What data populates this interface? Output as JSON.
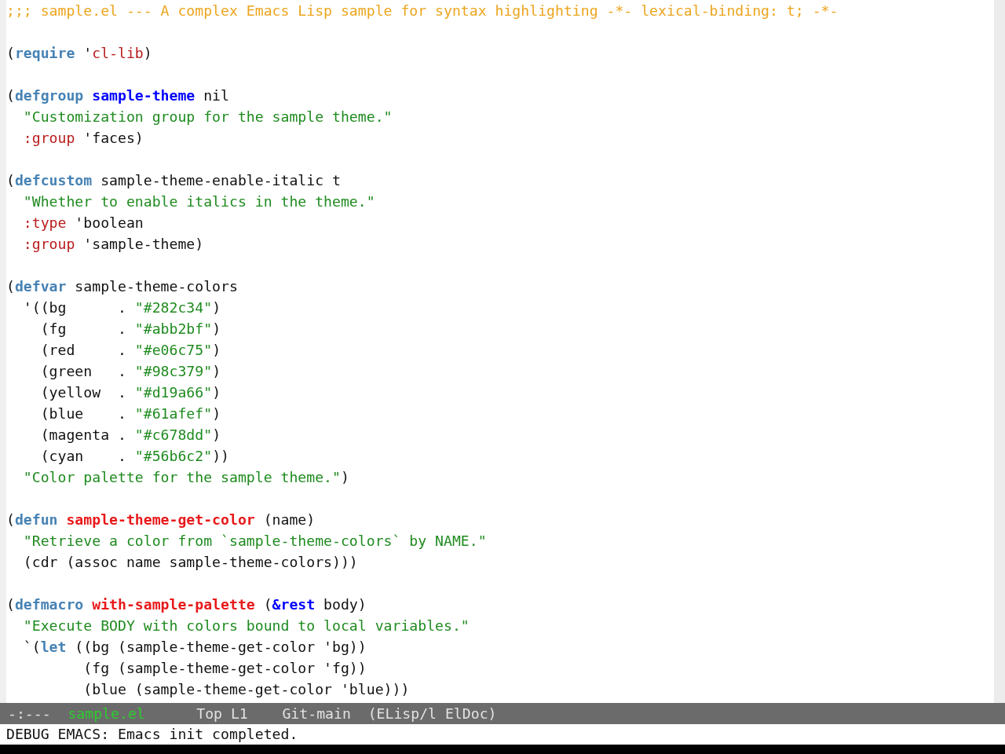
{
  "buffer": {
    "forms": [
      {
        "lines": [
          {
            "segments": [
              {
                "kind": "comment",
                "text": ";;; sample.el --- A complex Emacs Lisp sample for syntax highlighting -*- lexical-binding: t; -*-"
              }
            ]
          }
        ]
      },
      {
        "lines": [
          {
            "segments": [
              {
                "kind": "plain",
                "text": "("
              },
              {
                "kind": "keyword",
                "text": "require"
              },
              {
                "kind": "plain",
                "text": " '"
              },
              {
                "kind": "constant",
                "text": "cl-lib"
              },
              {
                "kind": "plain",
                "text": ")"
              }
            ]
          }
        ]
      },
      {
        "lines": [
          {
            "segments": [
              {
                "kind": "plain",
                "text": "("
              },
              {
                "kind": "keyword",
                "text": "defgroup"
              },
              {
                "kind": "type",
                "text": " sample-theme"
              },
              {
                "kind": "plain",
                "text": " nil"
              }
            ]
          },
          {
            "segments": [
              {
                "kind": "string",
                "text": "  \"Customization group for the sample theme.\""
              }
            ]
          },
          {
            "segments": [
              {
                "kind": "builtin",
                "text": "  :group"
              },
              {
                "kind": "plain",
                "text": " 'faces)"
              }
            ]
          }
        ]
      },
      {
        "lines": [
          {
            "segments": [
              {
                "kind": "plain",
                "text": "("
              },
              {
                "kind": "keyword",
                "text": "defcustom"
              },
              {
                "kind": "plain",
                "text": " sample-theme-enable-italic t"
              }
            ]
          },
          {
            "segments": [
              {
                "kind": "string",
                "text": "  \"Whether to enable italics in the theme.\""
              }
            ]
          },
          {
            "segments": [
              {
                "kind": "builtin",
                "text": "  :type"
              },
              {
                "kind": "plain",
                "text": " 'boolean"
              }
            ]
          },
          {
            "segments": [
              {
                "kind": "builtin",
                "text": "  :group"
              },
              {
                "kind": "plain",
                "text": " 'sample-theme)"
              }
            ]
          }
        ]
      },
      {
        "lines": [
          {
            "segments": [
              {
                "kind": "plain",
                "text": "("
              },
              {
                "kind": "keyword",
                "text": "defvar"
              },
              {
                "kind": "plain",
                "text": " sample-theme-colors"
              }
            ]
          },
          {
            "segments": [
              {
                "kind": "plain",
                "text": "  '((bg      . "
              },
              {
                "kind": "string",
                "text": "\"#282c34\""
              },
              {
                "kind": "plain",
                "text": ")"
              }
            ]
          },
          {
            "segments": [
              {
                "kind": "plain",
                "text": "    (fg      . "
              },
              {
                "kind": "string",
                "text": "\"#abb2bf\""
              },
              {
                "kind": "plain",
                "text": ")"
              }
            ]
          },
          {
            "segments": [
              {
                "kind": "plain",
                "text": "    (red     . "
              },
              {
                "kind": "string",
                "text": "\"#e06c75\""
              },
              {
                "kind": "plain",
                "text": ")"
              }
            ]
          },
          {
            "segments": [
              {
                "kind": "plain",
                "text": "    (green   . "
              },
              {
                "kind": "string",
                "text": "\"#98c379\""
              },
              {
                "kind": "plain",
                "text": ")"
              }
            ]
          },
          {
            "segments": [
              {
                "kind": "plain",
                "text": "    (yellow  . "
              },
              {
                "kind": "string",
                "text": "\"#d19a66\""
              },
              {
                "kind": "plain",
                "text": ")"
              }
            ]
          },
          {
            "segments": [
              {
                "kind": "plain",
                "text": "    (blue    . "
              },
              {
                "kind": "string",
                "text": "\"#61afef\""
              },
              {
                "kind": "plain",
                "text": ")"
              }
            ]
          },
          {
            "segments": [
              {
                "kind": "plain",
                "text": "    (magenta . "
              },
              {
                "kind": "string",
                "text": "\"#c678dd\""
              },
              {
                "kind": "plain",
                "text": ")"
              }
            ]
          },
          {
            "segments": [
              {
                "kind": "plain",
                "text": "    (cyan    . "
              },
              {
                "kind": "string",
                "text": "\"#56b6c2\""
              },
              {
                "kind": "plain",
                "text": "))"
              }
            ]
          },
          {
            "segments": [
              {
                "kind": "string",
                "text": "  \"Color palette for the sample theme.\""
              },
              {
                "kind": "plain",
                "text": ")"
              }
            ]
          }
        ]
      },
      {
        "lines": [
          {
            "segments": [
              {
                "kind": "plain",
                "text": "("
              },
              {
                "kind": "keyword",
                "text": "defun"
              },
              {
                "kind": "function",
                "text": " sample-theme-get-color"
              },
              {
                "kind": "plain",
                "text": " (name)"
              }
            ]
          },
          {
            "segments": [
              {
                "kind": "string",
                "text": "  \"Retrieve a color from `sample-theme-colors` by NAME.\""
              }
            ]
          },
          {
            "segments": [
              {
                "kind": "plain",
                "text": "  (cdr (assoc name sample-theme-colors)))"
              }
            ]
          }
        ]
      },
      {
        "lines": [
          {
            "segments": [
              {
                "kind": "plain",
                "text": "("
              },
              {
                "kind": "keyword",
                "text": "defmacro"
              },
              {
                "kind": "function",
                "text": " with-sample-palette"
              },
              {
                "kind": "plain",
                "text": " ("
              },
              {
                "kind": "type",
                "text": "&rest"
              },
              {
                "kind": "plain",
                "text": " body)"
              }
            ]
          },
          {
            "segments": [
              {
                "kind": "string",
                "text": "  \"Execute BODY with colors bound to local variables.\""
              }
            ]
          },
          {
            "segments": [
              {
                "kind": "plain",
                "text": "  `("
              },
              {
                "kind": "keyword",
                "text": "let"
              },
              {
                "kind": "plain",
                "text": " ((bg (sample-theme-get-color 'bg))"
              }
            ]
          },
          {
            "segments": [
              {
                "kind": "plain",
                "text": "         (fg (sample-theme-get-color 'fg))"
              }
            ]
          },
          {
            "segments": [
              {
                "kind": "plain",
                "text": "         (blue (sample-theme-get-color 'blue)))"
              }
            ]
          }
        ]
      }
    ]
  },
  "mode_line": {
    "status": "-:---",
    "buffer_name": "sample.el",
    "position": "Top L1",
    "vc_branch": "Git-main",
    "modes": "(ELisp/l ElDoc)"
  },
  "echo_area": {
    "message": "DEBUG EMACS: Emacs init completed."
  }
}
